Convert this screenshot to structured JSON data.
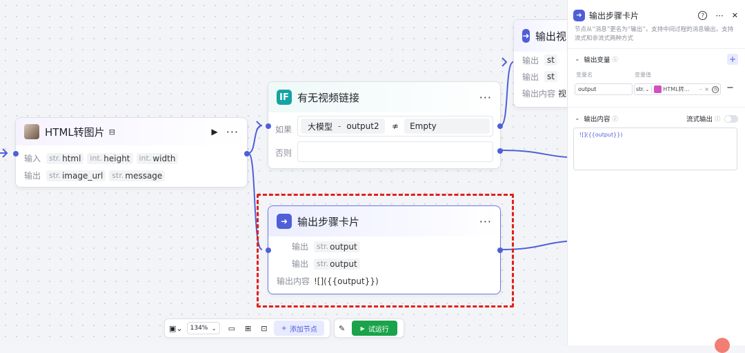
{
  "nodes": {
    "html_to_image": {
      "title": "HTML转图片",
      "input_label": "输入",
      "output_label": "输出",
      "inputs": [
        {
          "type": "str.",
          "name": "html"
        },
        {
          "type": "int.",
          "name": "height"
        },
        {
          "type": "int.",
          "name": "width"
        }
      ],
      "outputs": [
        {
          "type": "str.",
          "name": "image_url"
        },
        {
          "type": "str.",
          "name": "message"
        }
      ]
    },
    "condition": {
      "icon": "IF",
      "title": "有无视频链接",
      "if_label": "如果",
      "else_label": "否则",
      "left": "大模型",
      "dash": "-",
      "left_var": "output2",
      "operator": "≉",
      "right": "Empty"
    },
    "output_card_selected": {
      "title": "输出步骤卡片",
      "output_label": "输出",
      "outputs": [
        {
          "type": "str.",
          "name": "output"
        },
        {
          "type": "str.",
          "name": "output"
        }
      ],
      "content_label": "输出内容",
      "content": "![]({{output}})"
    },
    "output_card_top": {
      "title": "输出视",
      "output_label": "输出",
      "out1": "st",
      "out2": "st",
      "content_label": "输出内容",
      "content": "视"
    }
  },
  "panel": {
    "title": "输出步骤卡片",
    "help_icon": "?",
    "more_icon": "···",
    "close_icon": "✕",
    "description": "节点从“消息”更名为“输出”，支持中间过程的消息输出，支持流式和非流式两种方式",
    "output_vars_label": "输出变量",
    "add_label": "+",
    "var_name_header": "变量名",
    "var_value_header": "变量值",
    "var_name": "output",
    "var_type": "str.",
    "var_ref": "HTML转…",
    "var_ref_sep": "-",
    "var_ref_clear": "×",
    "remove_label": "−",
    "content_label": "输出内容",
    "stream_label": "流式输出",
    "content_value": "![]({{output}})"
  },
  "toolbar": {
    "zoom": "134%",
    "add_node": "添加节点",
    "run": "试运行"
  },
  "colors": {
    "accent": "#4e5fd8",
    "run_green": "#1aa34a",
    "selection_red": "#e0201b",
    "if_teal": "#14a3a3"
  }
}
